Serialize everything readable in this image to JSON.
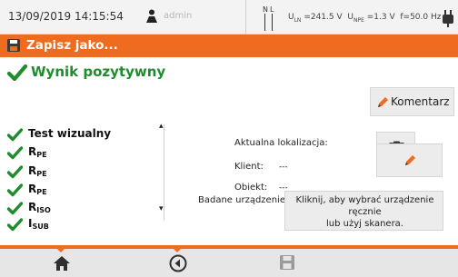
{
  "status_bar": {
    "datetime": "13/09/2019 14:15:54",
    "user": "admin",
    "phase_n": "N",
    "phase_l": "L",
    "measurements": "U",
    "u_ln_label": "U",
    "u_ln_sub": "LN",
    "u_ln_value": "=241.5 V",
    "u_npe_label": "U",
    "u_npe_sub": "NPE",
    "u_npe_value": "=1.3 V",
    "frequency": "f=50.0 Hz"
  },
  "title_bar": {
    "title": "Zapisz jako..."
  },
  "result": {
    "text": "Wynik pozytywny",
    "color": "#1f8c2e"
  },
  "buttons": {
    "comment_label": "Komentarz"
  },
  "test_list": {
    "items": [
      {
        "label": "Test wizualny",
        "sub": ""
      },
      {
        "label": "R",
        "sub": "PE"
      },
      {
        "label": "R",
        "sub": "PE"
      },
      {
        "label": "R",
        "sub": "PE"
      },
      {
        "label": "R",
        "sub": "ISO"
      },
      {
        "label": "I",
        "sub": "SUB"
      }
    ]
  },
  "fields": {
    "location_label": "Aktualna lokalizacja:",
    "client_label": "Klient:",
    "client_value": "---",
    "object_label": "Obiekt:",
    "object_value": "---",
    "device_label": "Badane urządzenie:",
    "device_button_line1": "Kliknij, aby wybrać urządzenie",
    "device_button_line2": "ręcznie",
    "device_button_line3": "lub użyj skanera."
  },
  "icons": {
    "user": "person-icon",
    "plug": "plug-icon",
    "save": "floppy-disk-icon",
    "check": "check-icon",
    "pencil": "pencil-icon",
    "location": "clipboard-list-icon",
    "home": "home-icon",
    "back": "back-arrow-icon",
    "save_nav": "floppy-disk-icon"
  },
  "colors": {
    "accent": "#ee6b1f",
    "success": "#1f8c2e"
  }
}
